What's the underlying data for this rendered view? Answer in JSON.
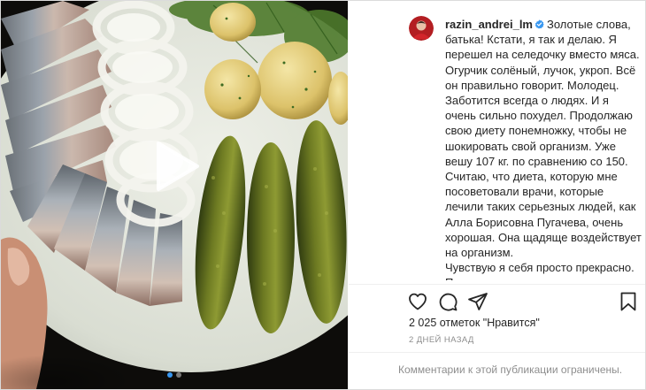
{
  "post": {
    "username": "razin_andrei_lm",
    "caption_lines": [
      "Золотые слова, батька! Кстати, я так и делаю. Я перешел на селедочку вместо мяса. Огурчик солёный, лучок, укроп. Всё он правильно говорит. Молодец. Заботится всегда о людях. И я очень сильно похудел. Продолжаю свою диету понемножку, чтобы не шокировать свой организм. Уже вешу 107 кг. по сравнению со 150. Считаю, что диета, которую мне посоветовали врачи, которые лечили таких серьезных людей, как Алла Борисовна Пугачева, очень хорошая. Она щадяще воздействует на организм.",
      "Чувствую я себя просто прекрасно. Поэтому кушаем селедочку с картошечкой и огурчиком, слушаем батьку, и не забываем, что с"
    ],
    "likes_text": "2 025 отметок \"Нравится\"",
    "date_text": "2 ДНЕЙ НАЗАД",
    "comments_text": "Комментарии к этой публикации ограничены."
  },
  "media": {
    "carousel_count": 2,
    "active_index": 0
  },
  "icons": {
    "verified": "verified-badge-icon",
    "like": "heart-icon",
    "comment": "comment-icon",
    "share": "paper-plane-icon",
    "save": "bookmark-icon",
    "play": "play-icon",
    "next": "chevron-right-icon"
  },
  "colors": {
    "accent": "#3897f0",
    "text": "#262626",
    "muted": "#8e8e8e",
    "border": "#dbdbdb"
  }
}
